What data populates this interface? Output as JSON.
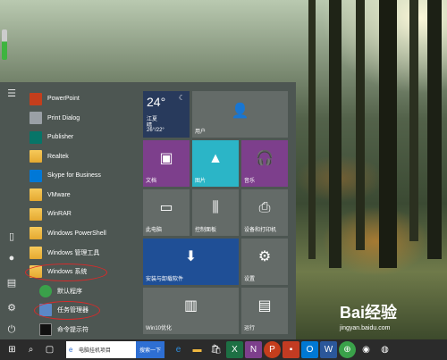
{
  "start_menu": {
    "apps": [
      {
        "label": "PowerPoint",
        "icon": "powerpoint-icon",
        "color": "#c43e1c"
      },
      {
        "label": "Print Dialog",
        "icon": "print-dialog-icon",
        "color": "#9aa0a6"
      },
      {
        "label": "Publisher",
        "icon": "publisher-icon",
        "color": "#077568"
      },
      {
        "label": "Realtek",
        "icon": "folder-icon",
        "color": "#f0b840"
      },
      {
        "label": "Skype for Business",
        "icon": "skype-icon",
        "color": "#0078d7"
      },
      {
        "label": "VMware",
        "icon": "folder-icon",
        "color": "#f0b840"
      },
      {
        "label": "WinRAR",
        "icon": "folder-icon",
        "color": "#f0b840"
      },
      {
        "label": "Windows PowerShell",
        "icon": "folder-icon",
        "color": "#f0b840"
      },
      {
        "label": "Windows 管理工具",
        "icon": "folder-icon",
        "color": "#f0b840"
      },
      {
        "label": "Windows 系统",
        "icon": "folder-icon",
        "color": "#f0b840"
      },
      {
        "label": "默认程序",
        "icon": "default-programs-icon",
        "color": "#3aa14a"
      },
      {
        "label": "任务管理器",
        "icon": "task-manager-icon",
        "color": "#5b88c7"
      },
      {
        "label": "命令提示符",
        "icon": "command-prompt-icon",
        "color": "#111111"
      }
    ]
  },
  "tiles": {
    "weather": {
      "temp": "24°",
      "city": "江夏",
      "condition": "晴",
      "range": "26°/22°"
    },
    "user": {
      "label": "用户"
    },
    "documents": {
      "label": "文档"
    },
    "pictures": {
      "label": "图片"
    },
    "music": {
      "label": "音乐"
    },
    "this_pc": {
      "label": "此电脑"
    },
    "control_panel": {
      "label": "控制面板"
    },
    "devices_printers": {
      "label": "设备和打印机"
    },
    "install_uninstall": {
      "label": "安装与卸载软件"
    },
    "settings": {
      "label": "设置"
    },
    "win10_optimize": {
      "label": "Win10优化"
    },
    "run": {
      "label": "运行"
    }
  },
  "taskbar": {
    "search_placeholder": "电脑挂机项目",
    "search_button": "搜索一下"
  },
  "watermark": {
    "text": "Bai经验",
    "url": "jingyan.baidu.com"
  },
  "colors": {
    "start_bg": "#4d5652",
    "accent_purple": "#7d3f8c",
    "accent_teal": "#2bb5c7",
    "tile_blue": "#1f4f96",
    "tile_navy": "#283a5c",
    "tile_gray": "#646b68"
  }
}
